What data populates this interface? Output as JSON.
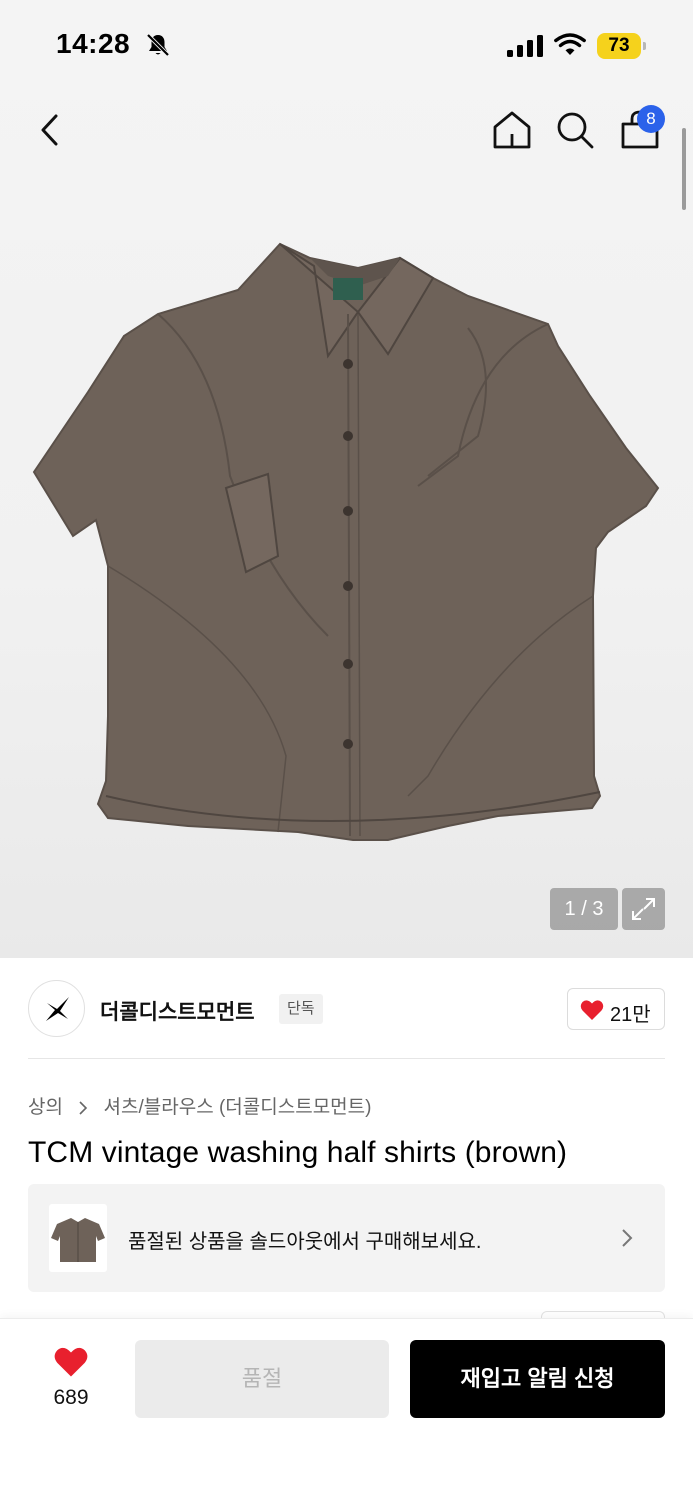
{
  "status_bar": {
    "time": "14:28",
    "battery": "73"
  },
  "header": {
    "cart_count": "8"
  },
  "gallery": {
    "page_indicator": "1 / 3"
  },
  "brand": {
    "name": "더콜디스트모먼트",
    "badge": "단독",
    "like_count": "21만"
  },
  "breadcrumb": {
    "category": "상의",
    "subcategory": "셔츠/블라우스 (더콜디스트모먼트)"
  },
  "product": {
    "title": "TCM vintage washing half shirts (brown)"
  },
  "soldout_banner": {
    "text": "품절된 상품을 솔드아웃에서 구매해보세요."
  },
  "bottom_bar": {
    "like_count": "689",
    "soldout_label": "품절",
    "restock_label": "재입고 알림 신청"
  },
  "colors": {
    "accent_blue": "#2b62ea",
    "heart_red": "#e8202e",
    "battery_yellow": "#f5d21c",
    "shirt_brown": "#6d6159"
  }
}
